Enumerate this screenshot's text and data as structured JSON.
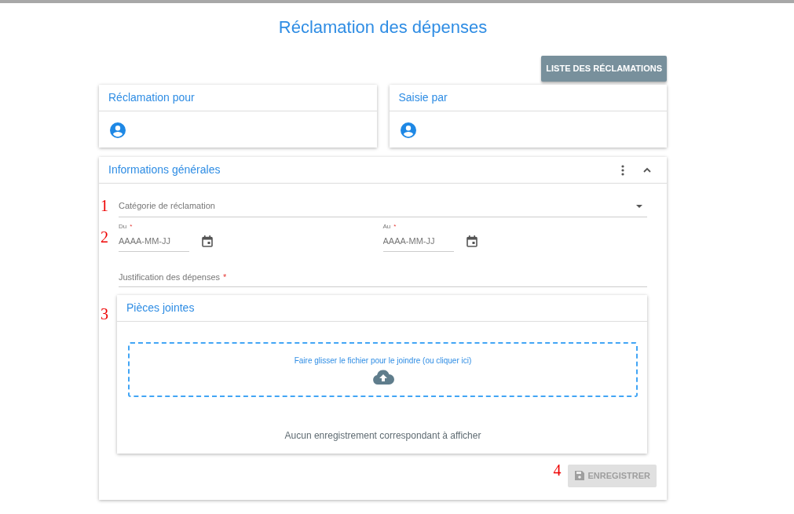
{
  "page_title": "Réclamation des dépenses",
  "list_button": "LISTE DES RÉCLAMATIONS",
  "person_cards": [
    {
      "title": "Réclamation pour"
    },
    {
      "title": "Saisie par"
    }
  ],
  "general_info": {
    "title": "Informations générales",
    "expanded": true,
    "category": {
      "placeholder": "Catégorie de réclamation",
      "annotation": "1"
    },
    "dates": {
      "annotation": "2",
      "fields": [
        {
          "label": "Du",
          "required_mark": "*",
          "placeholder": "AAAA-MM-JJ"
        },
        {
          "label": "Au",
          "required_mark": "*",
          "placeholder": "AAAA-MM-JJ"
        }
      ]
    },
    "justification": {
      "placeholder": "Justification des dépenses",
      "required_mark": "*"
    },
    "attachments": {
      "title": "Pièces jointes",
      "annotation": "3",
      "dropzone_text": "Faire glisser le fichier pour le joindre (ou cliquer ici)",
      "empty_text": "Aucun enregistrement correspondant à afficher"
    },
    "save_button": {
      "label": "ENREGISTRER",
      "disabled": true,
      "annotation": "4"
    }
  }
}
